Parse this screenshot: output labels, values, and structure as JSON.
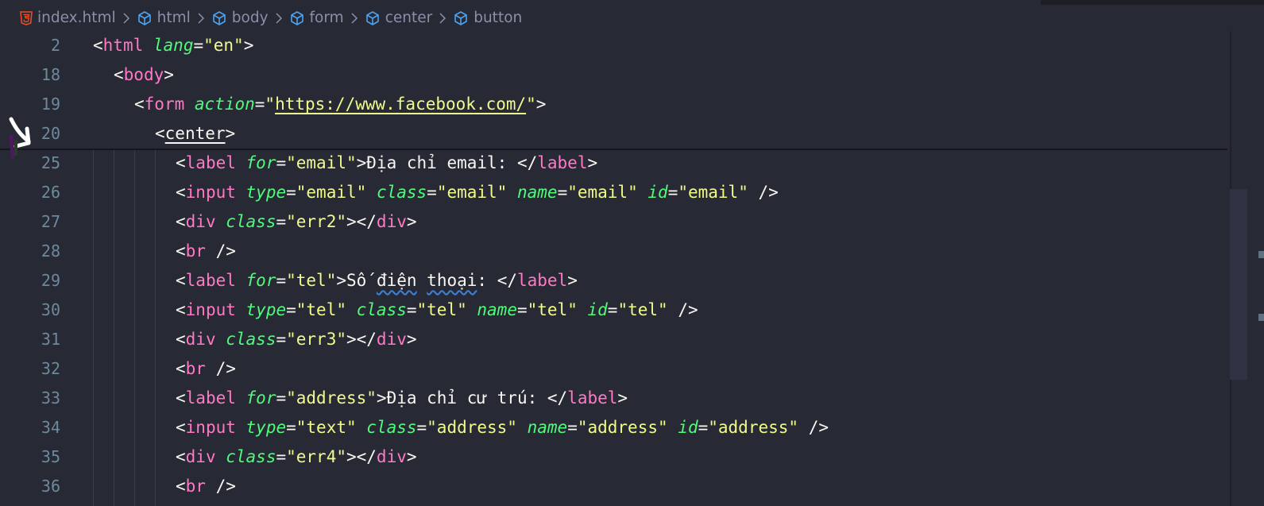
{
  "breadcrumb": {
    "file": "index.html",
    "items": [
      "html",
      "body",
      "form",
      "center",
      "button"
    ]
  },
  "sticky_lines": [
    {
      "num": "2",
      "indent": 0,
      "tokens": [
        {
          "c": "p",
          "v": "<"
        },
        {
          "c": "t",
          "v": "html"
        },
        {
          "c": "p",
          "v": " "
        },
        {
          "c": "a",
          "v": "lang"
        },
        {
          "c": "p",
          "v": "="
        },
        {
          "c": "s",
          "v": "\"en\""
        },
        {
          "c": "p",
          "v": ">"
        }
      ]
    },
    {
      "num": "18",
      "indent": 1,
      "tokens": [
        {
          "c": "p",
          "v": "<"
        },
        {
          "c": "t",
          "v": "body"
        },
        {
          "c": "p",
          "v": ">"
        }
      ]
    },
    {
      "num": "19",
      "indent": 2,
      "tokens": [
        {
          "c": "p",
          "v": "<"
        },
        {
          "c": "t",
          "v": "form"
        },
        {
          "c": "p",
          "v": " "
        },
        {
          "c": "a",
          "v": "action"
        },
        {
          "c": "p",
          "v": "="
        },
        {
          "c": "s",
          "v": "\""
        },
        {
          "c": "s u",
          "v": "https://www.facebook.com/"
        },
        {
          "c": "s",
          "v": "\""
        },
        {
          "c": "p",
          "v": ">"
        }
      ]
    },
    {
      "num": "20",
      "indent": 3,
      "tokens": [
        {
          "c": "p",
          "v": "<"
        },
        {
          "c": "x u",
          "v": "center"
        },
        {
          "c": "p",
          "v": ">"
        }
      ]
    }
  ],
  "code_lines": [
    {
      "num": "25",
      "tokens": [
        {
          "c": "p",
          "v": "<"
        },
        {
          "c": "t",
          "v": "label"
        },
        {
          "c": "p",
          "v": " "
        },
        {
          "c": "a",
          "v": "for"
        },
        {
          "c": "p",
          "v": "="
        },
        {
          "c": "s",
          "v": "\"email\""
        },
        {
          "c": "p",
          "v": ">"
        },
        {
          "c": "x",
          "v": "Địa chỉ email: "
        },
        {
          "c": "p",
          "v": "</"
        },
        {
          "c": "t",
          "v": "label"
        },
        {
          "c": "p",
          "v": ">"
        }
      ]
    },
    {
      "num": "26",
      "tokens": [
        {
          "c": "p",
          "v": "<"
        },
        {
          "c": "t",
          "v": "input"
        },
        {
          "c": "p",
          "v": " "
        },
        {
          "c": "a",
          "v": "type"
        },
        {
          "c": "p",
          "v": "="
        },
        {
          "c": "s",
          "v": "\"email\""
        },
        {
          "c": "p",
          "v": " "
        },
        {
          "c": "a",
          "v": "class"
        },
        {
          "c": "p",
          "v": "="
        },
        {
          "c": "s",
          "v": "\"email\""
        },
        {
          "c": "p",
          "v": " "
        },
        {
          "c": "a",
          "v": "name"
        },
        {
          "c": "p",
          "v": "="
        },
        {
          "c": "s",
          "v": "\"email\""
        },
        {
          "c": "p",
          "v": " "
        },
        {
          "c": "a",
          "v": "id"
        },
        {
          "c": "p",
          "v": "="
        },
        {
          "c": "s",
          "v": "\"email\""
        },
        {
          "c": "p",
          "v": " />"
        }
      ]
    },
    {
      "num": "27",
      "tokens": [
        {
          "c": "p",
          "v": "<"
        },
        {
          "c": "t",
          "v": "div"
        },
        {
          "c": "p",
          "v": " "
        },
        {
          "c": "a",
          "v": "class"
        },
        {
          "c": "p",
          "v": "="
        },
        {
          "c": "s",
          "v": "\"err2\""
        },
        {
          "c": "p",
          "v": "></"
        },
        {
          "c": "t",
          "v": "div"
        },
        {
          "c": "p",
          "v": ">"
        }
      ]
    },
    {
      "num": "28",
      "tokens": [
        {
          "c": "p",
          "v": "<"
        },
        {
          "c": "t",
          "v": "br"
        },
        {
          "c": "p",
          "v": " />"
        }
      ]
    },
    {
      "num": "29",
      "tokens": [
        {
          "c": "p",
          "v": "<"
        },
        {
          "c": "t",
          "v": "label"
        },
        {
          "c": "p",
          "v": " "
        },
        {
          "c": "a",
          "v": "for"
        },
        {
          "c": "p",
          "v": "="
        },
        {
          "c": "s",
          "v": "\"tel\""
        },
        {
          "c": "p",
          "v": ">"
        },
        {
          "c": "x",
          "v": "Số "
        },
        {
          "c": "x squig",
          "v": "điện"
        },
        {
          "c": "x",
          "v": " "
        },
        {
          "c": "x squig",
          "v": "thoại"
        },
        {
          "c": "x",
          "v": ": "
        },
        {
          "c": "p",
          "v": "</"
        },
        {
          "c": "t",
          "v": "label"
        },
        {
          "c": "p",
          "v": ">"
        }
      ]
    },
    {
      "num": "30",
      "tokens": [
        {
          "c": "p",
          "v": "<"
        },
        {
          "c": "t",
          "v": "input"
        },
        {
          "c": "p",
          "v": " "
        },
        {
          "c": "a",
          "v": "type"
        },
        {
          "c": "p",
          "v": "="
        },
        {
          "c": "s",
          "v": "\"tel\""
        },
        {
          "c": "p",
          "v": " "
        },
        {
          "c": "a",
          "v": "class"
        },
        {
          "c": "p",
          "v": "="
        },
        {
          "c": "s",
          "v": "\"tel\""
        },
        {
          "c": "p",
          "v": " "
        },
        {
          "c": "a",
          "v": "name"
        },
        {
          "c": "p",
          "v": "="
        },
        {
          "c": "s",
          "v": "\"tel\""
        },
        {
          "c": "p",
          "v": " "
        },
        {
          "c": "a",
          "v": "id"
        },
        {
          "c": "p",
          "v": "="
        },
        {
          "c": "s",
          "v": "\"tel\""
        },
        {
          "c": "p",
          "v": " />"
        }
      ]
    },
    {
      "num": "31",
      "tokens": [
        {
          "c": "p",
          "v": "<"
        },
        {
          "c": "t",
          "v": "div"
        },
        {
          "c": "p",
          "v": " "
        },
        {
          "c": "a",
          "v": "class"
        },
        {
          "c": "p",
          "v": "="
        },
        {
          "c": "s",
          "v": "\"err3\""
        },
        {
          "c": "p",
          "v": "></"
        },
        {
          "c": "t",
          "v": "div"
        },
        {
          "c": "p",
          "v": ">"
        }
      ]
    },
    {
      "num": "32",
      "tokens": [
        {
          "c": "p",
          "v": "<"
        },
        {
          "c": "t",
          "v": "br"
        },
        {
          "c": "p",
          "v": " />"
        }
      ]
    },
    {
      "num": "33",
      "tokens": [
        {
          "c": "p",
          "v": "<"
        },
        {
          "c": "t",
          "v": "label"
        },
        {
          "c": "p",
          "v": " "
        },
        {
          "c": "a",
          "v": "for"
        },
        {
          "c": "p",
          "v": "="
        },
        {
          "c": "s",
          "v": "\"address\""
        },
        {
          "c": "p",
          "v": ">"
        },
        {
          "c": "x",
          "v": "Địa chỉ cư trú: "
        },
        {
          "c": "p",
          "v": "</"
        },
        {
          "c": "t",
          "v": "label"
        },
        {
          "c": "p",
          "v": ">"
        }
      ]
    },
    {
      "num": "34",
      "tokens": [
        {
          "c": "p",
          "v": "<"
        },
        {
          "c": "t",
          "v": "input"
        },
        {
          "c": "p",
          "v": " "
        },
        {
          "c": "a",
          "v": "type"
        },
        {
          "c": "p",
          "v": "="
        },
        {
          "c": "s",
          "v": "\"text\""
        },
        {
          "c": "p",
          "v": " "
        },
        {
          "c": "a",
          "v": "class"
        },
        {
          "c": "p",
          "v": "="
        },
        {
          "c": "s",
          "v": "\"address\""
        },
        {
          "c": "p",
          "v": " "
        },
        {
          "c": "a",
          "v": "name"
        },
        {
          "c": "p",
          "v": "="
        },
        {
          "c": "s",
          "v": "\"address\""
        },
        {
          "c": "p",
          "v": " "
        },
        {
          "c": "a",
          "v": "id"
        },
        {
          "c": "p",
          "v": "="
        },
        {
          "c": "s",
          "v": "\"address\""
        },
        {
          "c": "p",
          "v": " />"
        }
      ]
    },
    {
      "num": "35",
      "tokens": [
        {
          "c": "p",
          "v": "<"
        },
        {
          "c": "t",
          "v": "div"
        },
        {
          "c": "p",
          "v": " "
        },
        {
          "c": "a",
          "v": "class"
        },
        {
          "c": "p",
          "v": "="
        },
        {
          "c": "s",
          "v": "\"err4\""
        },
        {
          "c": "p",
          "v": "></"
        },
        {
          "c": "t",
          "v": "div"
        },
        {
          "c": "p",
          "v": ">"
        }
      ]
    },
    {
      "num": "36",
      "tokens": [
        {
          "c": "p",
          "v": "<"
        },
        {
          "c": "t",
          "v": "br"
        },
        {
          "c": "p",
          "v": " />"
        }
      ]
    }
  ],
  "colors": {
    "background": "#272935",
    "tag": "#ff79c6",
    "attribute": "#50fa7b",
    "string": "#f1fa8c",
    "text": "#f8f8f2",
    "line_number": "#6d8a9c"
  },
  "icons": [
    "html5-icon",
    "cube-icon",
    "chevron-right-icon"
  ]
}
